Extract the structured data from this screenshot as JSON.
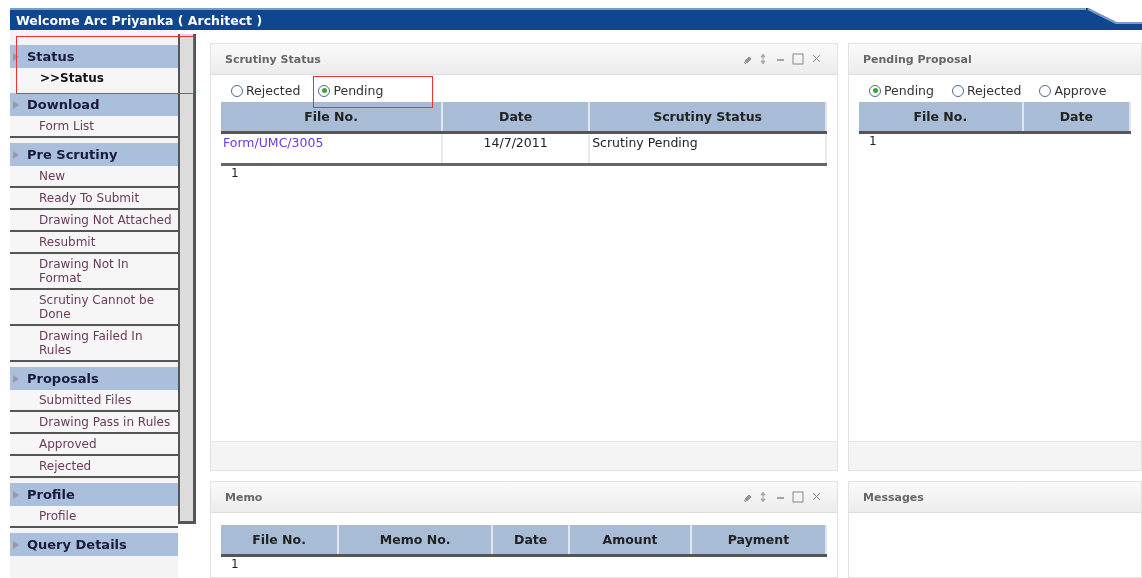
{
  "header": {
    "title": "Welcome Arc Priyanka ( Architect )"
  },
  "sidebar": {
    "groups": [
      {
        "title": "Status",
        "items": [
          {
            "label": ">>Status",
            "selected": true
          }
        ]
      },
      {
        "title": "Download",
        "items": [
          {
            "label": "Form List",
            "selected": false
          }
        ]
      },
      {
        "title": "Pre Scrutiny",
        "items": [
          {
            "label": "New",
            "selected": false
          },
          {
            "label": "Ready To Submit",
            "selected": false
          },
          {
            "label": "Drawing Not Attached",
            "selected": false
          },
          {
            "label": "Resubmit",
            "selected": false
          },
          {
            "label": "Drawing Not In Format",
            "selected": false
          },
          {
            "label": "Scrutiny Cannot be Done",
            "selected": false
          },
          {
            "label": "Drawing Failed In Rules",
            "selected": false
          }
        ]
      },
      {
        "title": "Proposals",
        "items": [
          {
            "label": "Submitted Files",
            "selected": false
          },
          {
            "label": "Drawing Pass in Rules",
            "selected": false
          },
          {
            "label": "Approved",
            "selected": false
          },
          {
            "label": "Rejected",
            "selected": false
          }
        ]
      },
      {
        "title": "Profile",
        "items": [
          {
            "label": "Profile",
            "selected": false
          }
        ]
      },
      {
        "title": "Query Details"
      }
    ]
  },
  "panels": [
    {
      "title": "Scrutiny Status",
      "tools": true,
      "radios": [
        {
          "label": "Rejected",
          "selected": false
        },
        {
          "label": "Pending",
          "selected": true
        }
      ],
      "table": {
        "columns": [
          "File No.",
          "Date",
          "Scrutiny Status"
        ],
        "rows": [
          [
            "Form/UMC/3005",
            "14/7/2011",
            "Scrutiny Pending"
          ]
        ]
      },
      "pager": "1"
    },
    {
      "title": "Pending Proposal",
      "tools": false,
      "radios": [
        {
          "label": "Pending",
          "selected": true
        },
        {
          "label": "Rejected",
          "selected": false
        },
        {
          "label": "Approve",
          "selected": false
        }
      ],
      "table": {
        "columns": [
          "File No.",
          "Date"
        ]
      },
      "pager": "1"
    },
    {
      "title": "Memo",
      "tools": true,
      "table": {
        "columns": [
          "File No.",
          "Memo No.",
          "Date",
          "Amount",
          "Payment"
        ]
      },
      "pager": "1"
    },
    {
      "title": "Messages",
      "tools": false
    }
  ]
}
